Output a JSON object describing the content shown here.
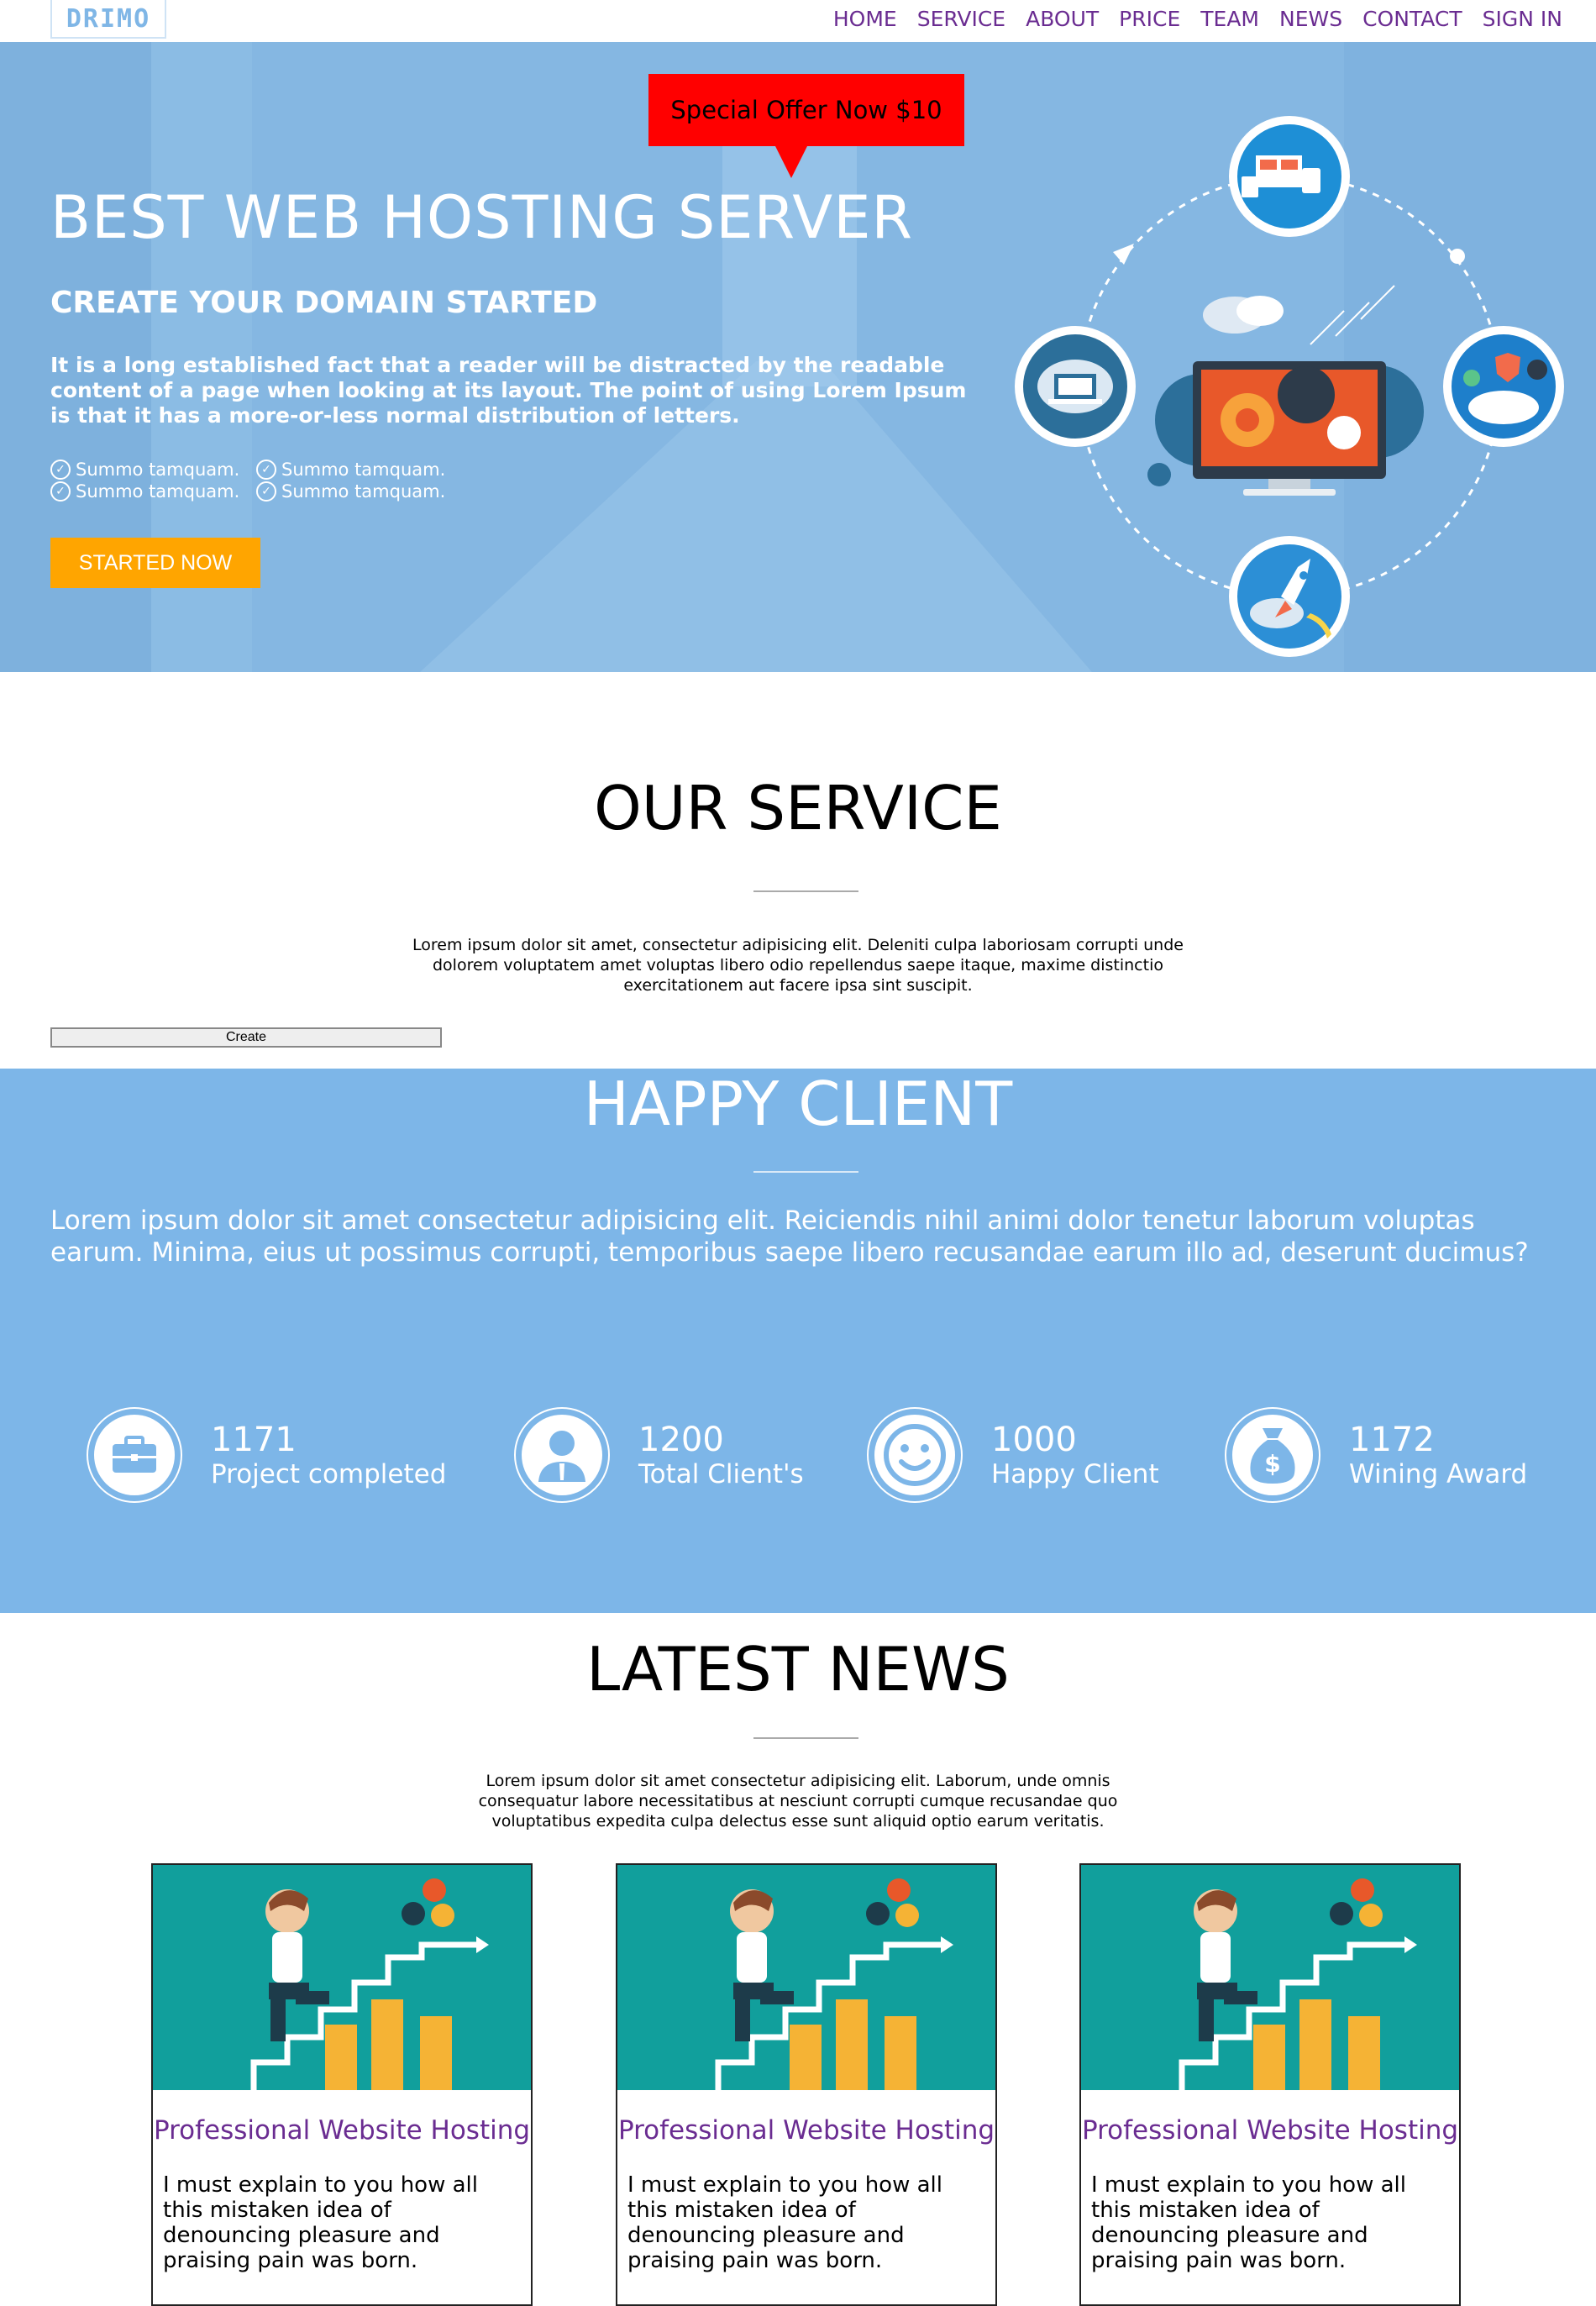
{
  "brand": {
    "logo": "DRIMO"
  },
  "nav": {
    "items": [
      "HOME",
      "SERVICE",
      "ABOUT",
      "PRICE",
      "TEAM",
      "NEWS",
      "CONTACT",
      "SIGN IN"
    ]
  },
  "hero": {
    "offer": "Special Offer Now $10",
    "title": "BEST WEB HOSTING SERVER",
    "subtitle": "CREATE YOUR DOMAIN STARTED",
    "text": "It is a long established fact that a reader will be distracted by the readable content of a page when looking at its layout. The point of using Lorem Ipsum is that it has a more-or-less normal distribution of letters.",
    "checks": [
      "Summo tamquam.",
      "Summo tamquam.",
      "Summo tamquam.",
      "Summo tamquam."
    ],
    "cta": "STARTED NOW"
  },
  "service": {
    "title": "OUR SERVICE",
    "text": "Lorem ipsum dolor sit amet, consectetur adipisicing elit. Deleniti culpa laboriosam corrupti unde dolorem voluptatem amet voluptas libero odio repellendus saepe itaque, maxime distinctio exercitationem aut facere ipsa sint suscipit.",
    "button": "Create"
  },
  "happy": {
    "title": "HAPPY CLIENT",
    "text": "Lorem ipsum dolor sit amet consectetur adipisicing elit. Reiciendis nihil animi dolor tenetur laborum voluptas earum. Minima, eius ut possimus corrupti, temporibus saepe libero recusandae earum illo ad, deserunt ducimus?",
    "stats": [
      {
        "number": "1171",
        "label": "Project completed",
        "icon": "briefcase-icon"
      },
      {
        "number": "1200",
        "label": "Total Client's",
        "icon": "user-icon"
      },
      {
        "number": "1000",
        "label": "Happy Client",
        "icon": "smiley-icon"
      },
      {
        "number": "1172",
        "label": "Wining Award",
        "icon": "money-bag-icon"
      }
    ]
  },
  "news": {
    "title": "LATEST NEWS",
    "text": "Lorem ipsum dolor sit amet consectetur adipisicing elit. Laborum, unde omnis consequatur labore necessitatibus at nesciunt corrupti cumque recusandae quo voluptatibus expedita culpa delectus esse sunt aliquid optio earum veritatis.",
    "cards": [
      {
        "title": "Professional Website Hosting",
        "body": "I must explain to you how all this mistaken idea of denouncing pleasure and praising pain was born."
      },
      {
        "title": "Professional Website Hosting",
        "body": "I must explain to you how all this mistaken idea of denouncing pleasure and praising pain was born."
      },
      {
        "title": "Professional Website Hosting",
        "body": "I must explain to you how all this mistaken idea of denouncing pleasure and praising pain was born."
      }
    ]
  },
  "colors": {
    "nav_link": "#6a2c91",
    "hero_bg": "#7fb2de",
    "offer": "#ff0000",
    "cta": "#ffa500",
    "happy_bg": "#7db6e8",
    "news_img_bg": "#119f9c"
  }
}
